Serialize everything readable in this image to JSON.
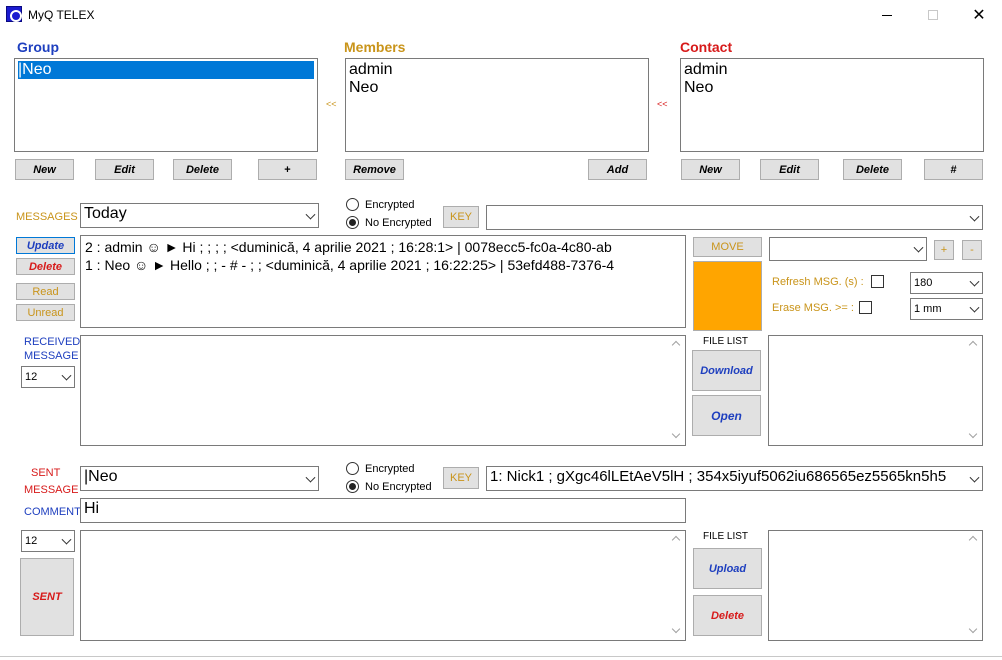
{
  "window": {
    "title": "MyQ TELEX"
  },
  "group": {
    "title": "Group",
    "items": [
      "|Neo"
    ],
    "buttons": {
      "new": "New",
      "edit": "Edit",
      "delete": "Delete",
      "plus": "+"
    }
  },
  "members": {
    "title": "Members",
    "arrow": "<<",
    "items": [
      "admin",
      "Neo"
    ],
    "buttons": {
      "remove": "Remove",
      "add": "Add"
    }
  },
  "contact": {
    "title": "Contact",
    "arrow": "<<",
    "items": [
      "admin",
      "Neo"
    ],
    "buttons": {
      "new": "New",
      "edit": "Edit",
      "delete": "Delete",
      "hash": "#"
    }
  },
  "messages": {
    "label": "MESSAGES",
    "filter_value": "Today",
    "encrypted_label": "Encrypted",
    "no_encrypted_label": "No Encrypted",
    "key_label": "KEY",
    "key_value": "",
    "side_buttons": {
      "update": "Update",
      "delete": "Delete",
      "read": "Read",
      "unread": "Unread"
    },
    "lines": [
      "2 : admin ☺ ► Hi  ;  ;  ;  ; <duminică, 4 aprilie 2021 ; 16:28:1> | 0078ecc5-fc0a-4c80-ab",
      "1 : Neo ☺ ► Hello  ; ; - # - ;  ; <duminică, 4 aprilie 2021 ; 16:22:25> | 53efd488-7376-4"
    ],
    "move_label": "MOVE",
    "move_target": "",
    "plus": "+",
    "minus": "-",
    "move_color": "#ffa500",
    "refresh_label": "Refresh MSG. (s) :",
    "refresh_value": "180",
    "erase_label": "Erase MSG. >= :",
    "erase_value": "1 mm"
  },
  "received": {
    "label_line1": "RECEIVED",
    "label_line2": "MESSAGE",
    "font_size": "12",
    "file_list_label": "FILE LIST",
    "download": "Download",
    "open": "Open"
  },
  "sent": {
    "label_line1": "SENT",
    "label_line2": "MESSAGE",
    "recipient": "|Neo",
    "encrypted_label": "Encrypted",
    "no_encrypted_label": "No Encrypted",
    "key_label": "KEY",
    "key_value": "1: Nick1 ; gXgc46lLEtAeV5lH ; 354x5iyuf5062iu686565ez5565kn5h5",
    "comment_label": "COMMENT",
    "comment_value": "Hi",
    "font_size": "12",
    "sent_button": "SENT",
    "file_list_label": "FILE LIST",
    "upload": "Upload",
    "delete": "Delete"
  },
  "colors": {
    "blue": "#1e3fbf",
    "gold": "#c9941a",
    "red": "#d71a1a",
    "selection": "#0078d7"
  }
}
